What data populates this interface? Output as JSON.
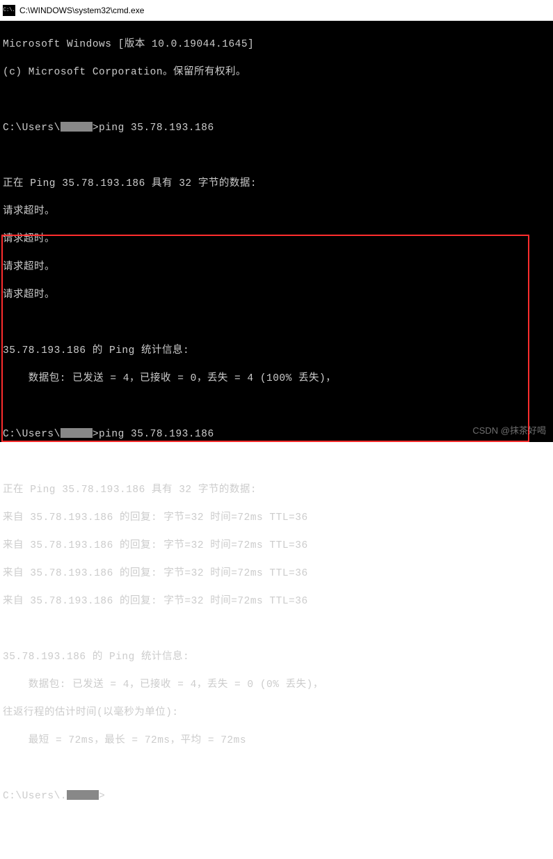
{
  "titlebar": {
    "iconText": "C:\\.",
    "title": "C:\\WINDOWS\\system32\\cmd.exe"
  },
  "terminal": {
    "header1": "Microsoft Windows [版本 10.0.19044.1645]",
    "header2": "(c) Microsoft Corporation。保留所有权利。",
    "prompt1_prefix": "C:\\Users\\",
    "prompt1_suffix": ">ping 35.78.193.186",
    "ping1_l1": "正在 Ping 35.78.193.186 具有 32 字节的数据:",
    "ping1_l2": "请求超时。",
    "ping1_l3": "请求超时。",
    "ping1_l4": "请求超时。",
    "ping1_l5": "请求超时。",
    "ping1_stat1": "35.78.193.186 的 Ping 统计信息:",
    "ping1_stat2": "    数据包: 已发送 = 4，已接收 = 0，丢失 = 4 (100% 丢失)，",
    "prompt2_prefix": "C:\\Users\\",
    "prompt2_suffix": ">ping 35.78.193.186",
    "ping2_l1": "正在 Ping 35.78.193.186 具有 32 字节的数据:",
    "ping2_l2": "来自 35.78.193.186 的回复: 字节=32 时间=72ms TTL=36",
    "ping2_l3": "来自 35.78.193.186 的回复: 字节=32 时间=72ms TTL=36",
    "ping2_l4": "来自 35.78.193.186 的回复: 字节=32 时间=72ms TTL=36",
    "ping2_l5": "来自 35.78.193.186 的回复: 字节=32 时间=72ms TTL=36",
    "ping2_stat1": "35.78.193.186 的 Ping 统计信息:",
    "ping2_stat2": "    数据包: 已发送 = 4，已接收 = 4，丢失 = 0 (0% 丢失)，",
    "ping2_stat3": "往返行程的估计时间(以毫秒为单位):",
    "ping2_stat4": "    最短 = 72ms，最长 = 72ms，平均 = 72ms",
    "prompt3_prefix": "C:\\Users\\.",
    "prompt3_suffix": ">"
  },
  "watermark": "CSDN @抹茶好喝"
}
